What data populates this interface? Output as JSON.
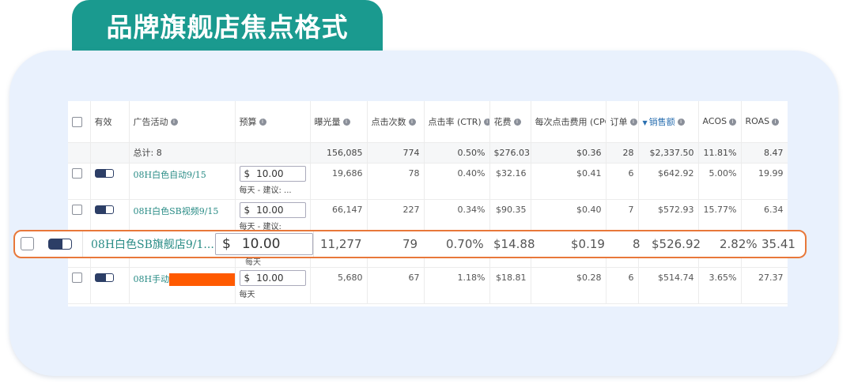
{
  "banner": {
    "title": "品牌旗舰店焦点格式"
  },
  "table": {
    "headers": {
      "valid": "有效",
      "campaign": "广告活动",
      "budget": "预算",
      "impressions": "曝光量",
      "clicks": "点击次数",
      "ctr": "点击率 (CTR)",
      "spend": "花费",
      "cpc": "每次点击费用 (CPC)",
      "orders": "订单",
      "sales": "销售额",
      "acos": "ACOS",
      "roas": "ROAS"
    },
    "totals": {
      "label": "总计: 8",
      "impressions": "156,085",
      "clicks": "774",
      "ctr": "0.50%",
      "spend": "$276.03",
      "cpc": "$0.36",
      "orders": "28",
      "sales": "$2,337.50",
      "acos": "11.81%",
      "roas": "8.47"
    },
    "rows": [
      {
        "name": "08H白色自动9/15",
        "currency": "$",
        "budget": "10.00",
        "budget_note": "每天 - 建议: ...",
        "impressions": "19,686",
        "clicks": "78",
        "ctr": "0.40%",
        "spend": "$32.16",
        "cpc": "$0.41",
        "orders": "6",
        "sales": "$642.92",
        "acos": "5.00%",
        "roas": "19.99"
      },
      {
        "name": "08H白色SB视频9/15",
        "currency": "$",
        "budget": "10.00",
        "budget_note": "每天 - 建议:",
        "impressions": "66,147",
        "clicks": "227",
        "ctr": "0.34%",
        "spend": "$90.35",
        "cpc": "$0.40",
        "orders": "7",
        "sales": "$572.93",
        "acos": "15.77%",
        "roas": "6.34"
      },
      {
        "name": "08H手动",
        "currency": "$",
        "budget": "10.00",
        "budget_note": "每天",
        "impressions": "5,680",
        "clicks": "67",
        "ctr": "1.18%",
        "spend": "$18.81",
        "cpc": "$0.28",
        "orders": "6",
        "sales": "$514.74",
        "acos": "3.65%",
        "roas": "27.37"
      }
    ],
    "highlight": {
      "name": "08H白色SB旗舰店9/1...",
      "currency": "$",
      "budget": "10.00",
      "budget_note": "每天",
      "impressions": "11,277",
      "clicks": "79",
      "ctr": "0.70%",
      "spend": "$14.88",
      "cpc": "$0.19",
      "orders": "8",
      "sales": "$526.92",
      "acos": "2.82%",
      "roas": "35.41"
    }
  },
  "colors": {
    "accent": "#1a9a8f",
    "highlight_border": "#e8783a",
    "redaction": "#ff5a00",
    "card_bg": "#e9f1fd"
  }
}
